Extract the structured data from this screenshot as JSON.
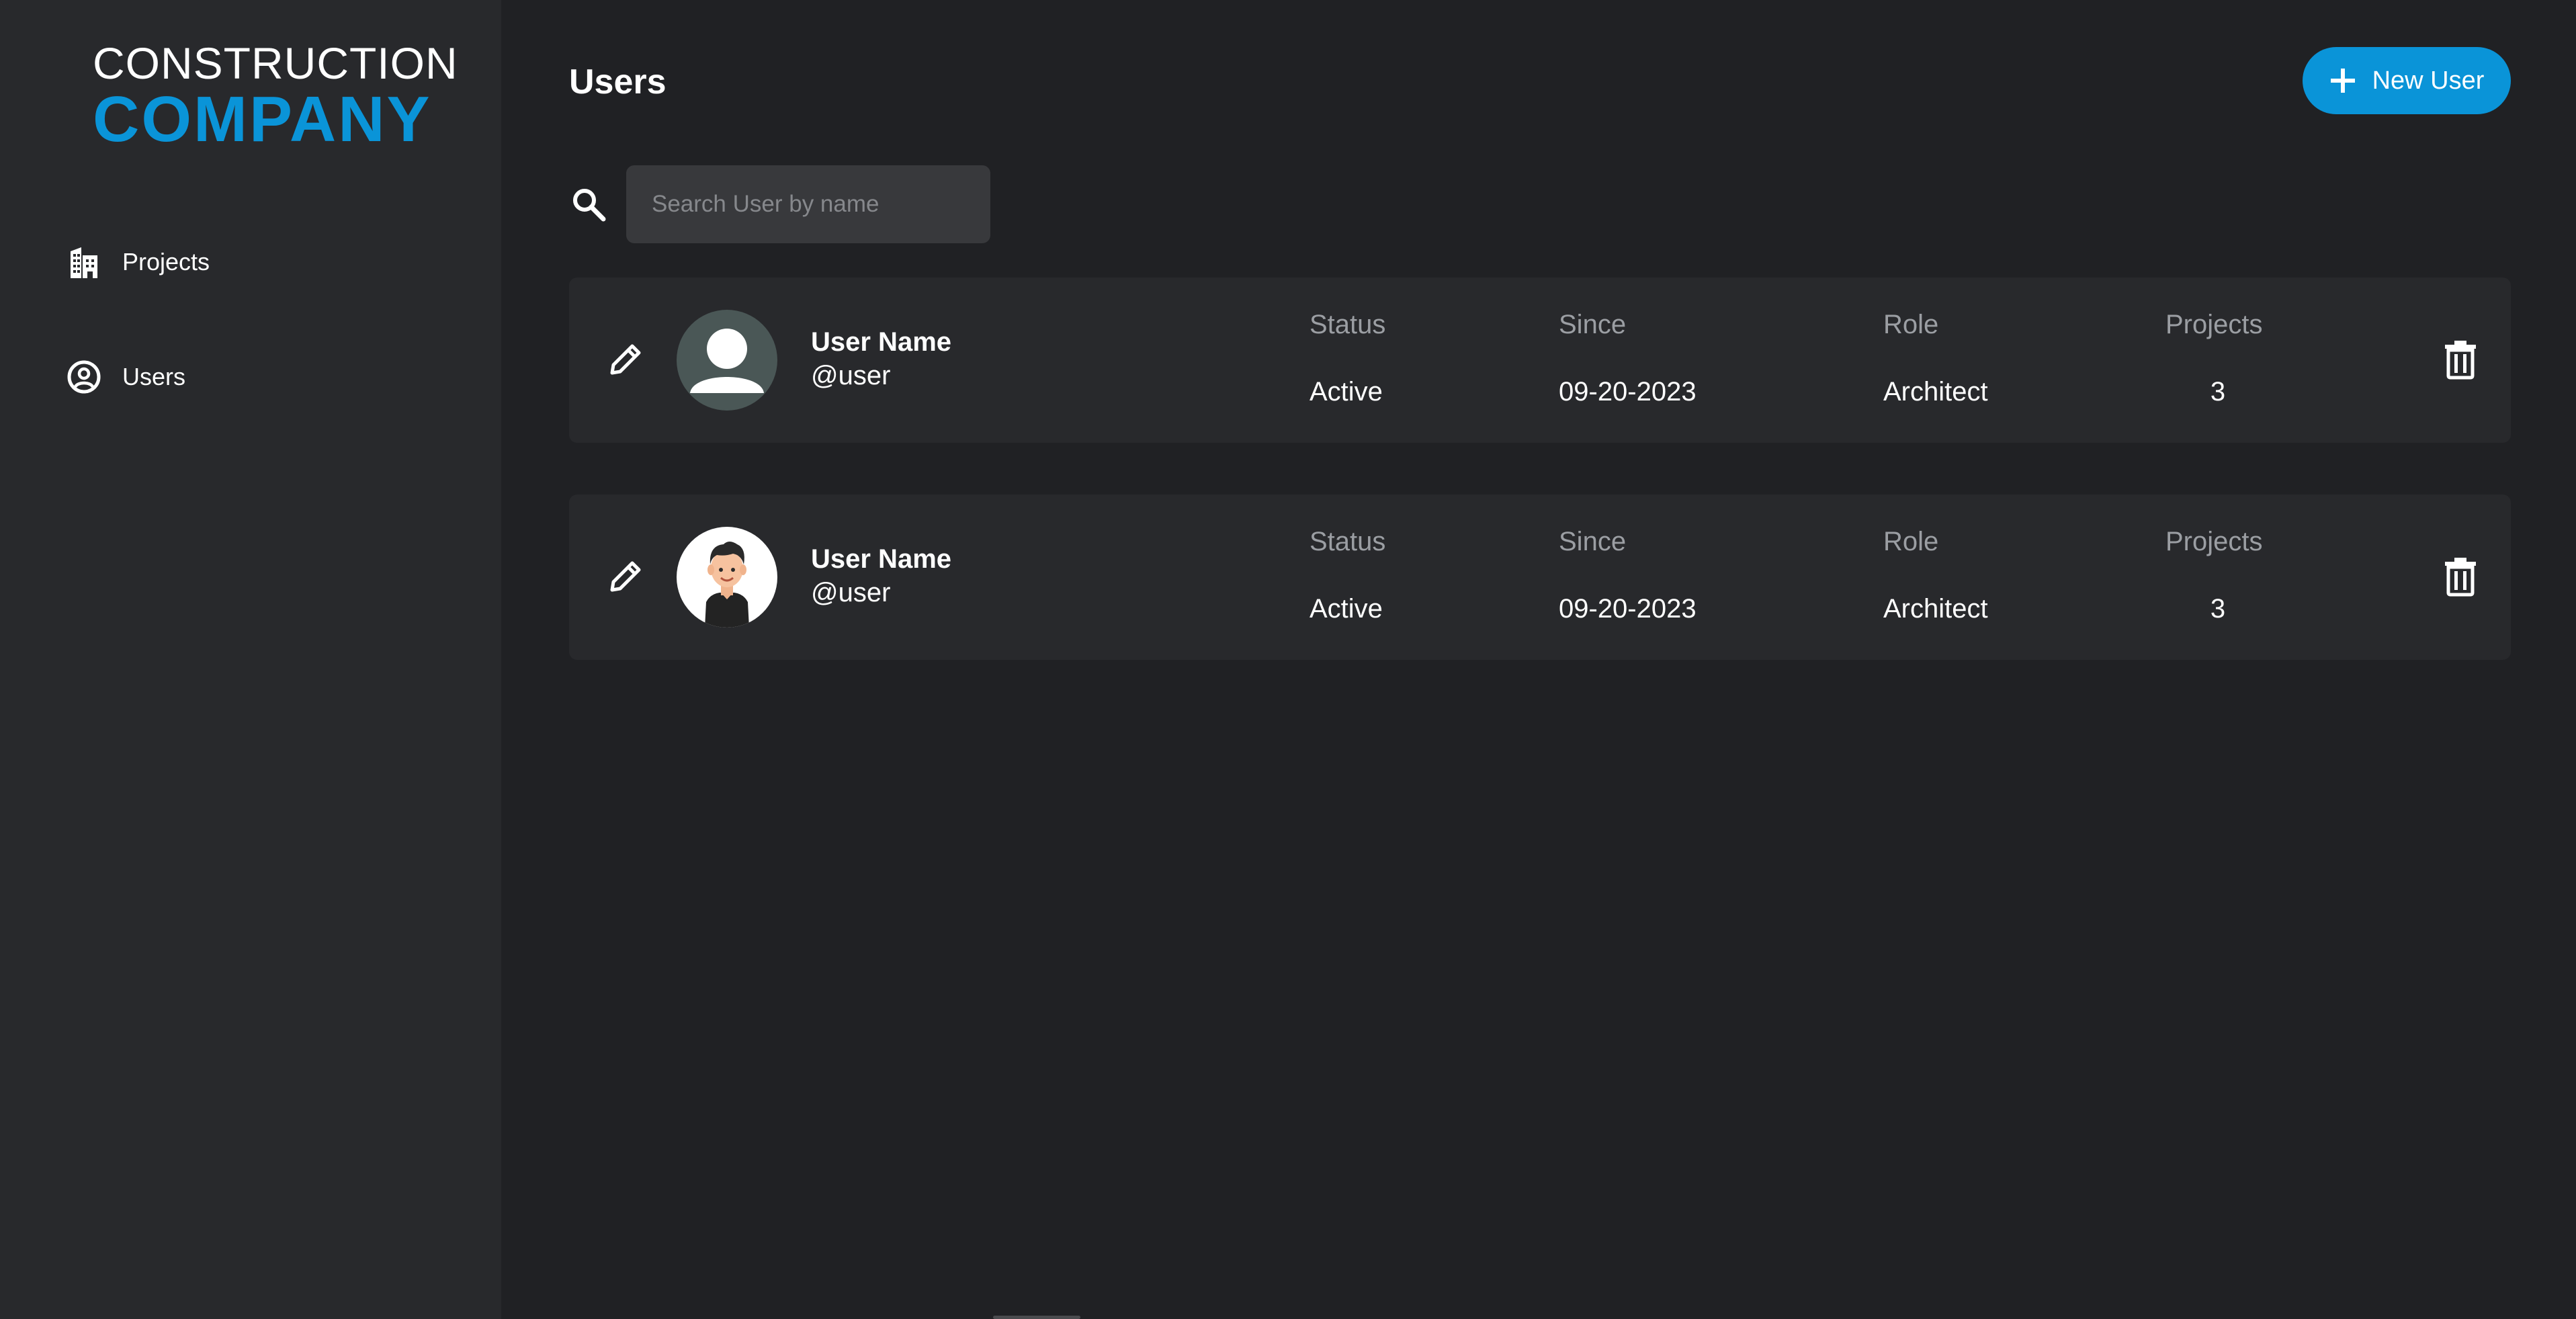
{
  "colors": {
    "accent": "#0a94d8",
    "background": "#202124",
    "sidebar": "#28292c",
    "card": "#28292c"
  },
  "logo": {
    "line1": "CONSTRUCTION",
    "line2": "COMPANY"
  },
  "sidebar": {
    "items": [
      {
        "label": "Projects",
        "icon": "building-icon"
      },
      {
        "label": "Users",
        "icon": "user-circle-icon"
      }
    ]
  },
  "header": {
    "title": "Users",
    "new_user_label": "New User"
  },
  "search": {
    "placeholder": "Search User by name",
    "value": ""
  },
  "columns": {
    "status": "Status",
    "since": "Since",
    "role": "Role",
    "projects": "Projects"
  },
  "users": [
    {
      "name": "User Name",
      "handle": "@user",
      "status": "Active",
      "since": "09-20-2023",
      "role": "Architect",
      "projects": "3",
      "avatar": "default-avatar"
    },
    {
      "name": "User Name",
      "handle": "@user",
      "status": "Active",
      "since": "09-20-2023",
      "role": "Architect",
      "projects": "3",
      "avatar": "cartoon-avatar"
    }
  ]
}
